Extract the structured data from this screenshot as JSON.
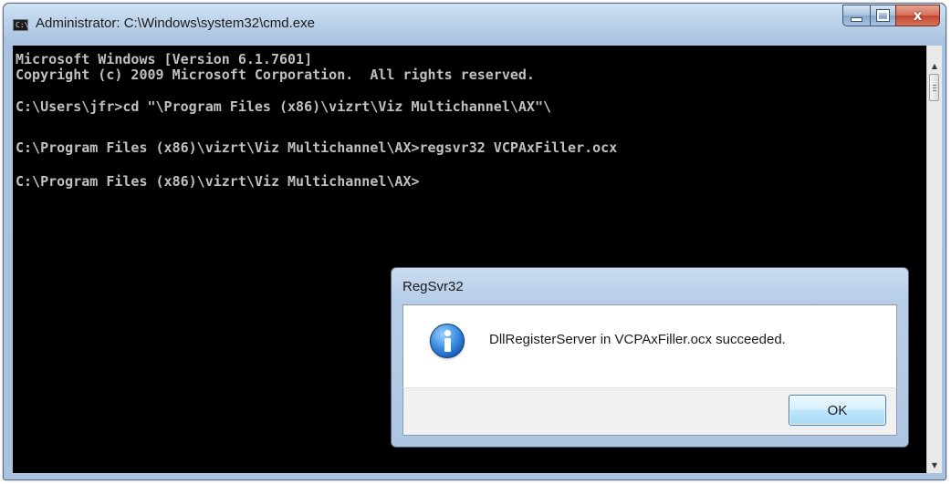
{
  "window": {
    "title": "Administrator: C:\\Windows\\system32\\cmd.exe",
    "icon": "cmd-console-icon",
    "icon_text": "C:\\",
    "close_glyph": "x"
  },
  "console": {
    "lines": [
      "Microsoft Windows [Version 6.1.7601]",
      "Copyright (c) 2009 Microsoft Corporation.  All rights reserved.",
      "C:\\Users\\jfr>cd \"\\Program Files (x86)\\vizrt\\Viz Multichannel\\AX\"\\",
      "C:\\Program Files (x86)\\vizrt\\Viz Multichannel\\AX>regsvr32 VCPAxFiller.ocx",
      "C:\\Program Files (x86)\\vizrt\\Viz Multichannel\\AX>"
    ],
    "text_color": "#c0c0c0",
    "background_color": "#000000"
  },
  "scrollbar": {
    "up_arrow": "▲",
    "down_arrow": "▼"
  },
  "dialog": {
    "title": "RegSvr32",
    "message": "DllRegisterServer in VCPAxFiller.ocx succeeded.",
    "icon": "information-icon",
    "ok_label": "OK"
  }
}
